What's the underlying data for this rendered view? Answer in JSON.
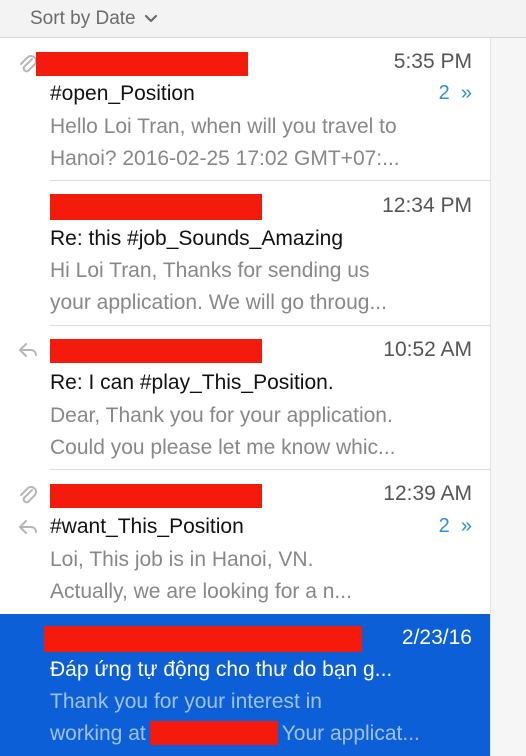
{
  "sort": {
    "label": "Sort by Date"
  },
  "messages": [
    {
      "time": "5:35 PM",
      "subject": "#open_Position",
      "thread_count": "2",
      "preview_line1": "Hello Loi Tran, when will you travel to",
      "preview_line2": "Hanoi? 2016-02-25 17:02 GMT+07:...",
      "icons": [
        "paperclip-icon"
      ]
    },
    {
      "time": "12:34 PM",
      "subject": "Re: this #job_Sounds_Amazing",
      "preview_line1": "Hi Loi Tran, Thanks for sending us",
      "preview_line2": "your application. We will go throug..."
    },
    {
      "time": "10:52 AM",
      "subject": "Re: I can #play_This_Position.",
      "preview_line1": "Dear, Thank you for your application.",
      "preview_line2": "Could you please let me know whic...",
      "icons": [
        "reply-arrow-icon"
      ]
    },
    {
      "time": "12:39 AM",
      "subject": "#want_This_Position",
      "thread_count": "2",
      "preview_line1": "Loi, This job is in Hanoi, VN.",
      "preview_line2": "Actually, we are looking for a n...",
      "icons": [
        "paperclip-icon",
        "reply-arrow-icon"
      ]
    },
    {
      "time": "2/23/16",
      "subject": "Đáp ứng tự động cho thư do bạn g...",
      "preview_line1": "Thank you for your interest in",
      "preview_line2_prefix": "working at",
      "preview_line2_suffix": "Your applicat...",
      "selected": true
    }
  ],
  "colors": {
    "selection": "#0c5fd6",
    "thread_count": "#2d8fe0",
    "redaction": "#f41b0d"
  }
}
